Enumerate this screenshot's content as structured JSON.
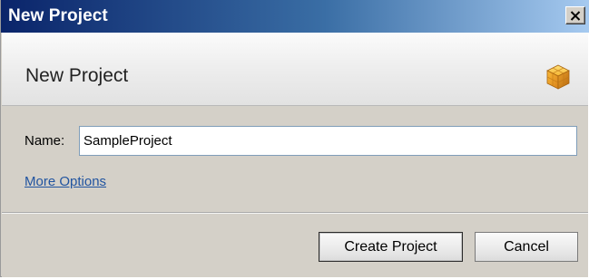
{
  "window": {
    "title": "New Project",
    "close_symbol": "×"
  },
  "header": {
    "title": "New Project",
    "icon": "project-cube-icon"
  },
  "form": {
    "name_label": "Name:",
    "name_value": "SampleProject",
    "more_options_label": "More Options"
  },
  "buttons": {
    "create_label": "Create Project",
    "cancel_label": "Cancel"
  },
  "colors": {
    "titlebar_start": "#0a246a",
    "titlebar_end": "#a6caf0",
    "dialog_bg": "#d4d0c8",
    "link": "#2154a0",
    "icon_orange": "#f0a020"
  }
}
